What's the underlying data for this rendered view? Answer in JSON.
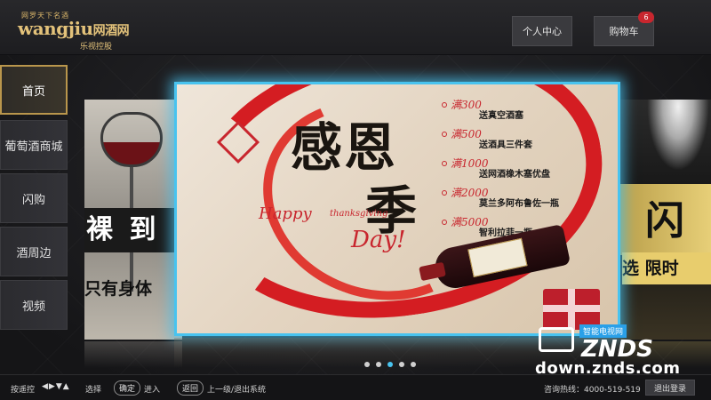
{
  "header": {
    "logo_tag": "网罗天下名酒",
    "logo_main": "wangjiu",
    "logo_cn": "网酒网",
    "logo_sub": "乐视控股",
    "user_center": "个人中心",
    "cart": "购物车",
    "cart_count": "6"
  },
  "sidebar": {
    "items": [
      {
        "label": "首页"
      },
      {
        "label": "葡萄酒商城"
      },
      {
        "label": "闪购"
      },
      {
        "label": "酒周边"
      },
      {
        "label": "视频"
      }
    ]
  },
  "carousel": {
    "left_banner": {
      "line1": "裸 到",
      "line2": "只有身体"
    },
    "main_banner": {
      "title_line1": "感恩",
      "title_line2": "季",
      "happy": "Happy",
      "thanksgiving": "thanksgiving",
      "day": "Day!",
      "promos": [
        {
          "amount": "满300",
          "text": "送真空酒塞"
        },
        {
          "amount": "满500",
          "text": "送酒具三件套"
        },
        {
          "amount": "满1000",
          "text": "送网酒橡木塞优盘"
        },
        {
          "amount": "满2000",
          "text": "莫兰多阿布鲁佐一瓶"
        },
        {
          "amount": "满5000",
          "text": "智利拉菲一瓶"
        }
      ]
    },
    "right_banner": {
      "big": "闪",
      "line": "选 限时"
    },
    "page_dots": 5,
    "active_dot": 2
  },
  "watermark": {
    "badge": "智能电视网",
    "brand": "ZNDS",
    "url": "down.znds.com"
  },
  "footer": {
    "remote_label": "按遥控",
    "arrows": "◀▶▼▲",
    "select_label": "选择",
    "ok_key": "确定",
    "enter_label": "进入",
    "back_key": "返回",
    "back_label": "上一级/退出系统",
    "hotline": "咨询热线：4000-519-519",
    "logout": "退出登录"
  },
  "colors": {
    "accent_border": "#48c3ef",
    "active_nav_border": "#b9964c",
    "badge_red": "#c8262e"
  }
}
